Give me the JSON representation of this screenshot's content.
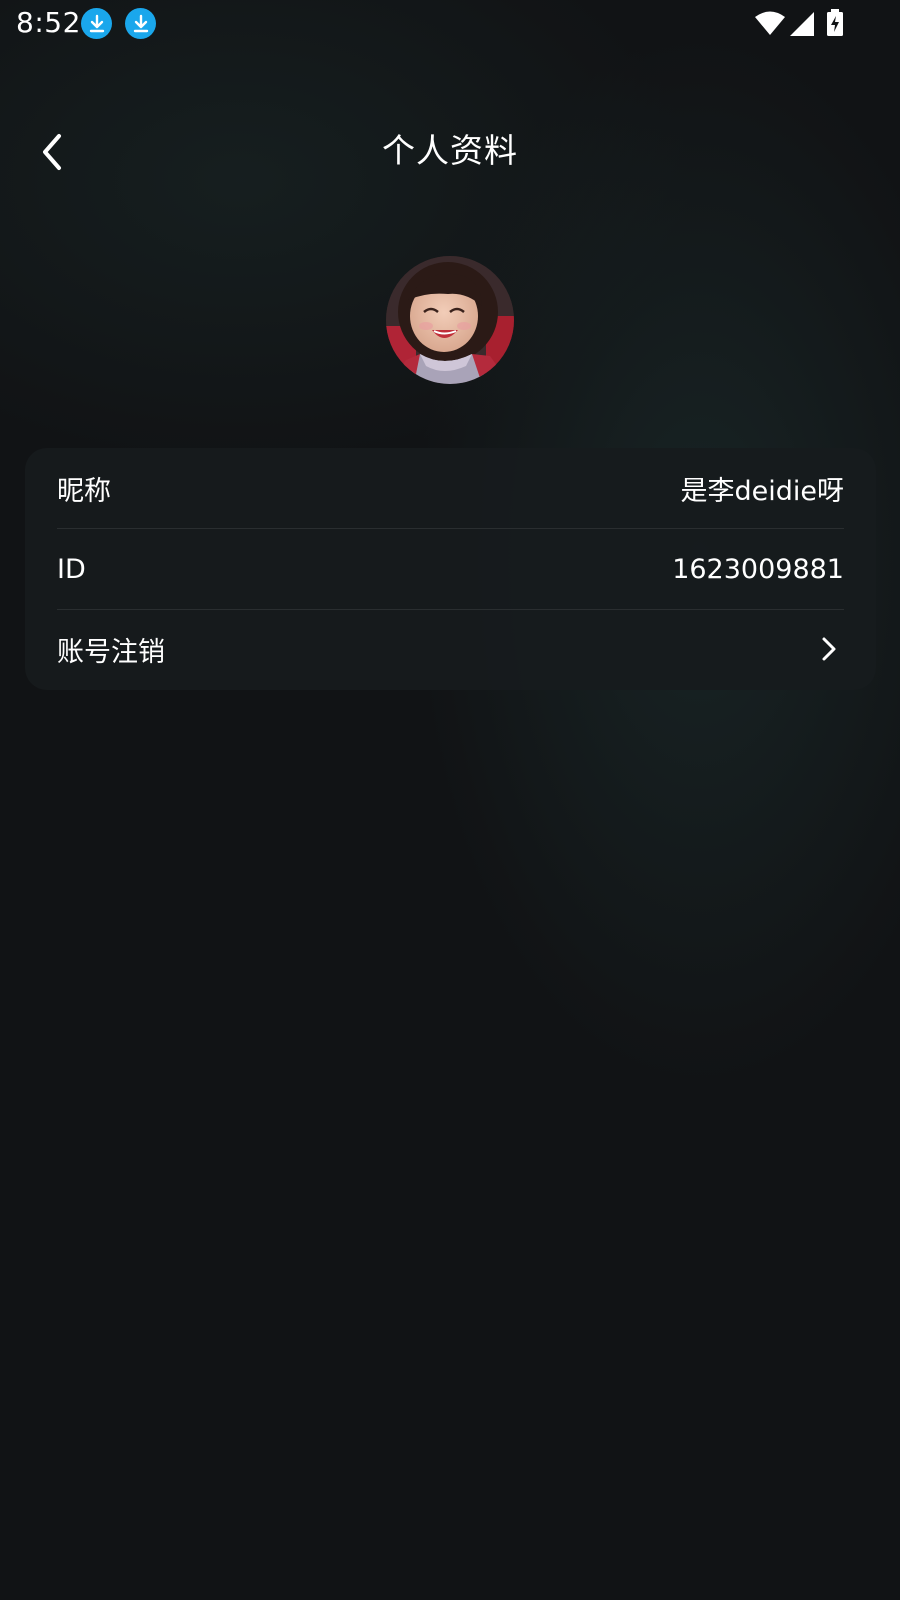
{
  "status_bar": {
    "time": "8:52",
    "icons": [
      "download-icon",
      "download-icon",
      "wifi-icon",
      "signal-icon",
      "battery-charging-icon"
    ],
    "download_icon_color": "#1aa7ec"
  },
  "header": {
    "title": "个人资料",
    "back_icon": "chevron-left-icon"
  },
  "profile": {
    "avatar": "avatar-photo"
  },
  "info_rows": [
    {
      "label": "昵称",
      "value": "是李deidie呀"
    },
    {
      "label": "ID",
      "value": "1623009881"
    },
    {
      "label": "账号注销",
      "icon": "chevron-right-icon"
    }
  ],
  "colors": {
    "background": "#111315",
    "card": "#171b1d",
    "text": "#ffffff",
    "divider": "#2a2e30"
  }
}
